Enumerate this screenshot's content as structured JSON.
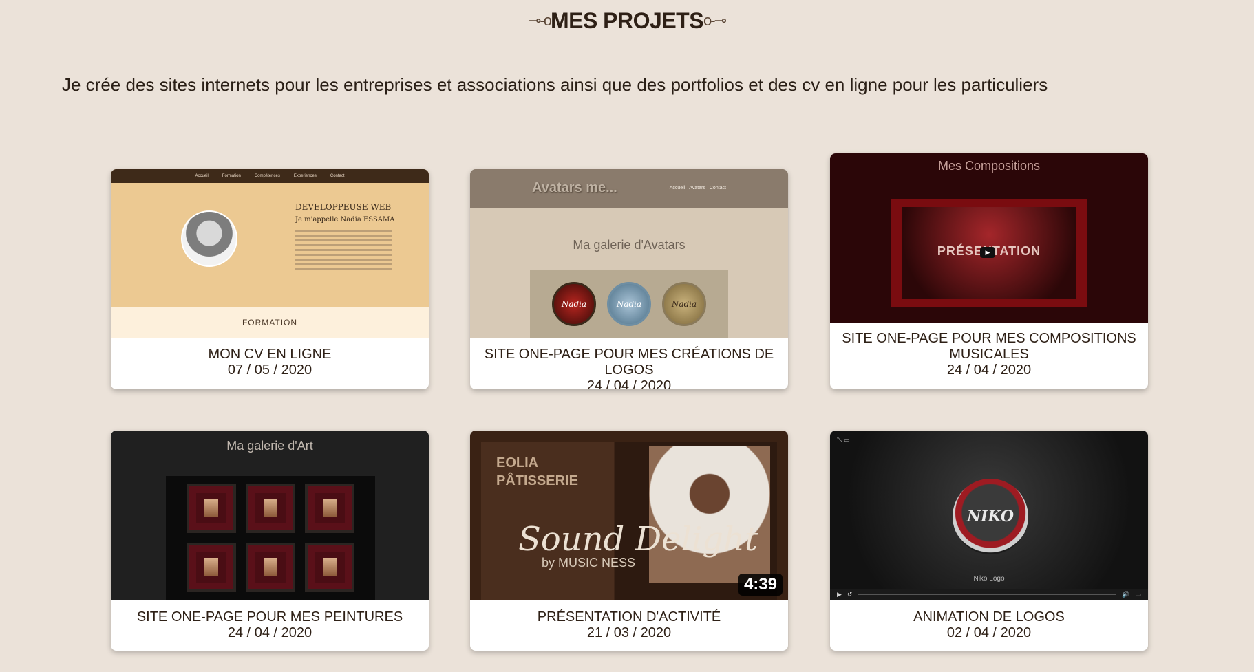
{
  "section": {
    "title_left_ornament": "⊸-o",
    "title": "MES PROJETS",
    "title_right_ornament": "o-⊸",
    "intro": "Je crée des sites internets pour les entreprises et associations ainsi que des portfolios et des cv en ligne pour les particuliers"
  },
  "projects": [
    {
      "title": "MON CV EN LIGNE",
      "date": "07 / 05 / 2020",
      "thumb": {
        "nav": [
          "Accueil",
          "Formation",
          "Compétences",
          "Experiences",
          "Contact"
        ],
        "heading": "DEVELOPPEUSE WEB",
        "name": "Je m'appelle Nadia ESSAMA",
        "band": "FORMATION"
      }
    },
    {
      "title": "SITE ONE-PAGE POUR MES CRÉATIONS DE LOGOS",
      "date": "24 / 04 / 2020",
      "thumb": {
        "brand": "Avatars me...",
        "menu": [
          "Accueil",
          "Avatars",
          "Contact"
        ],
        "gallery": "Ma galerie d'Avatars",
        "discs": [
          "Nadia",
          "Nadia",
          "Nadia"
        ]
      }
    },
    {
      "title": "SITE ONE-PAGE POUR MES COMPOSITIONS MUSICALES",
      "date": "24 / 04 / 2020",
      "thumb": {
        "heading": "Mes Compositions",
        "video_text": "PRÉSENTATION"
      }
    },
    {
      "title": "SITE ONE-PAGE POUR MES PEINTURES",
      "date": "24 / 04 / 2020",
      "thumb": {
        "heading": "Ma galerie d'Art"
      }
    },
    {
      "title": "PRÉSENTATION D'ACTIVITÉ",
      "date": "21 / 03 / 2020",
      "thumb": {
        "brand_line1": "EOLIA",
        "brand_line2": "PÂTISSERIE",
        "script": "Sound Delight",
        "byline": "by MUSIC NESS",
        "duration": "4:39"
      }
    },
    {
      "title": "ANIMATION DE LOGOS",
      "date": "02 / 04 / 2020",
      "thumb": {
        "logo": "NIKO",
        "label": "Niko Logo"
      }
    }
  ],
  "colors": {
    "background": "#ebe2d9",
    "text": "#2e2016",
    "card": "#ffffff"
  }
}
